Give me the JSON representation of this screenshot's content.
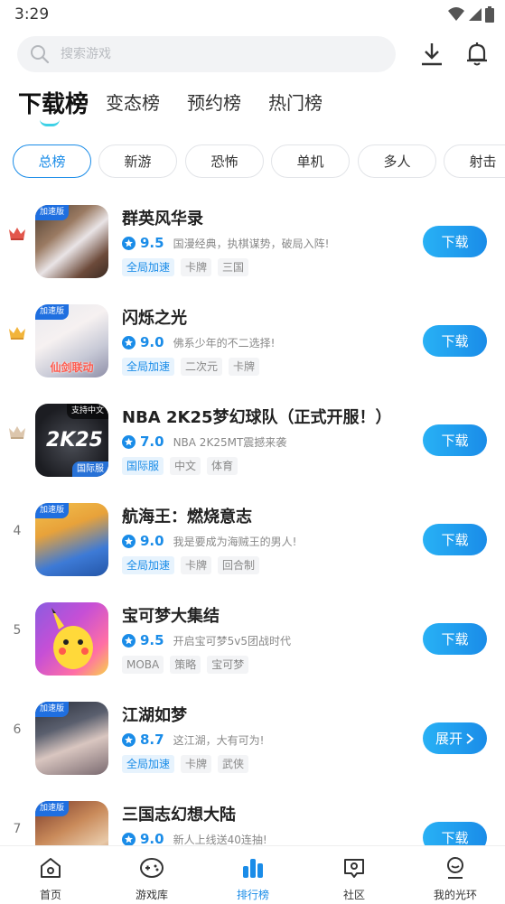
{
  "status_bar": {
    "time": "3:29"
  },
  "search": {
    "placeholder": "搜索游戏"
  },
  "main_tabs": [
    "下载榜",
    "变态榜",
    "预约榜",
    "热门榜"
  ],
  "chips": [
    "总榜",
    "新游",
    "恐怖",
    "单机",
    "多人",
    "射击"
  ],
  "apps": [
    {
      "rank": "1",
      "name": "群英风华录",
      "score": "9.5",
      "desc": "国漫经典，执棋谋势，破局入阵!",
      "tags": [
        "全局加速",
        "卡牌",
        "三国"
      ],
      "button": "下载",
      "badge": "加速版"
    },
    {
      "rank": "2",
      "name": "闪烁之光",
      "score": "9.0",
      "desc": "佛系少年的不二选择!",
      "tags": [
        "全局加速",
        "二次元",
        "卡牌"
      ],
      "button": "下载",
      "badge": "加速版",
      "caption": "仙剑联动"
    },
    {
      "rank": "3",
      "name": "NBA 2K25梦幻球队（正式开服！）",
      "score": "7.0",
      "desc": "NBA 2K25MT震撼来袭",
      "tags": [
        "国际服",
        "中文",
        "体育"
      ],
      "button": "下载",
      "badge": "支持中文",
      "badge_br": "国际服",
      "logo_text": "2K25"
    },
    {
      "rank": "4",
      "name": "航海王：燃烧意志",
      "score": "9.0",
      "desc": "我是要成为海贼王的男人!",
      "tags": [
        "全局加速",
        "卡牌",
        "回合制"
      ],
      "button": "下载",
      "badge": "加速版"
    },
    {
      "rank": "5",
      "name": "宝可梦大集结",
      "score": "9.5",
      "desc": "开启宝可梦5v5团战时代",
      "tags": [
        "MOBA",
        "策略",
        "宝可梦"
      ],
      "button": "下载"
    },
    {
      "rank": "6",
      "name": "江湖如梦",
      "score": "8.7",
      "desc": "这江湖，大有可为!",
      "tags": [
        "全局加速",
        "卡牌",
        "武侠"
      ],
      "button": "展开",
      "badge": "加速版"
    },
    {
      "rank": "7",
      "name": "三国志幻想大陆",
      "score": "9.0",
      "desc": "新人上线送40连抽!",
      "tags": [],
      "button": "下载",
      "badge": "加速版"
    }
  ],
  "bottom_nav": [
    "首页",
    "游戏库",
    "排行榜",
    "社区",
    "我的光环"
  ],
  "colors": {
    "accent": "#1a8ce8",
    "button_gradient_start": "#28b1f5",
    "tab_indicator": "#3dd1e6"
  }
}
